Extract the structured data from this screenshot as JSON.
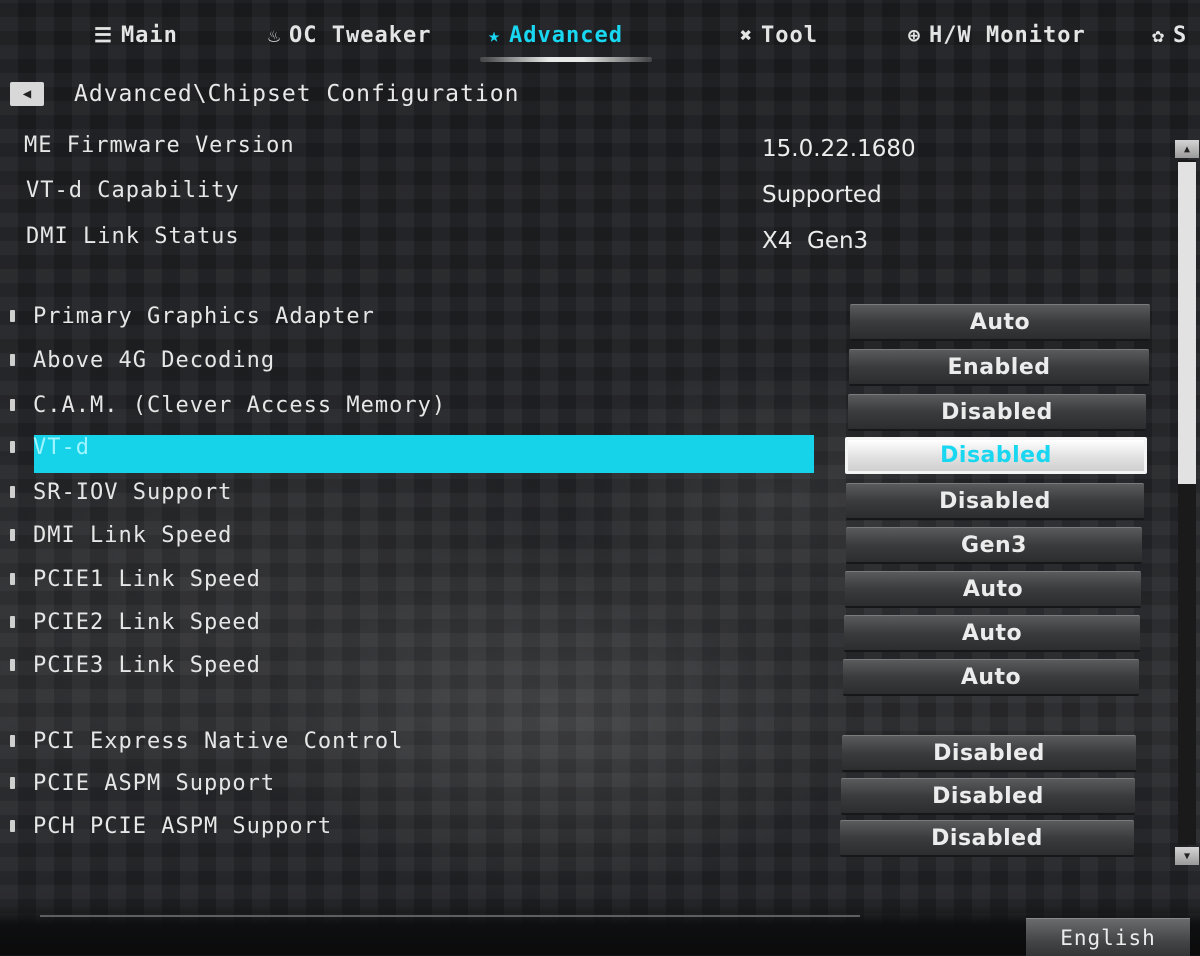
{
  "tabs": [
    {
      "label": "Main",
      "icon": "menu-icon",
      "active": false
    },
    {
      "label": "OC Tweaker",
      "icon": "flame-icon",
      "active": false
    },
    {
      "label": "Advanced",
      "icon": "star-icon",
      "active": true
    },
    {
      "label": "Tool",
      "icon": "tools-icon",
      "active": false
    },
    {
      "label": "H/W Monitor",
      "icon": "crosshair-icon",
      "active": false
    },
    {
      "label": "S",
      "icon": "gear-icon",
      "active": false
    }
  ],
  "breadcrumb": "Advanced\\Chipset Configuration",
  "info": [
    {
      "label": "ME Firmware Version",
      "value": "15.0.22.1680"
    },
    {
      "label": "VT-d Capability",
      "value": "Supported"
    },
    {
      "label": "DMI Link Status",
      "value": "X4  Gen3"
    }
  ],
  "options": [
    {
      "label": "Primary Graphics Adapter",
      "value": "Auto"
    },
    {
      "label": "Above 4G Decoding",
      "value": "Enabled"
    },
    {
      "label": "C.A.M. (Clever Access Memory)",
      "value": "Disabled"
    },
    {
      "label": "VT-d",
      "value": "Disabled",
      "selected": true
    },
    {
      "label": "SR-IOV Support",
      "value": "Disabled"
    },
    {
      "label": "DMI Link Speed",
      "value": "Gen3"
    },
    {
      "label": "PCIE1 Link Speed",
      "value": "Auto"
    },
    {
      "label": "PCIE2 Link Speed",
      "value": "Auto"
    },
    {
      "label": "PCIE3 Link Speed",
      "value": "Auto"
    },
    {
      "label": "PCI Express Native Control",
      "value": "Disabled"
    },
    {
      "label": "PCIE ASPM Support",
      "value": "Disabled"
    },
    {
      "label": "PCH PCIE ASPM Support",
      "value": "Disabled"
    }
  ],
  "colors": {
    "accent": "#19d7f0",
    "highlight": "#16d3ea",
    "background": "#141517"
  },
  "footer": {
    "language": "English"
  }
}
